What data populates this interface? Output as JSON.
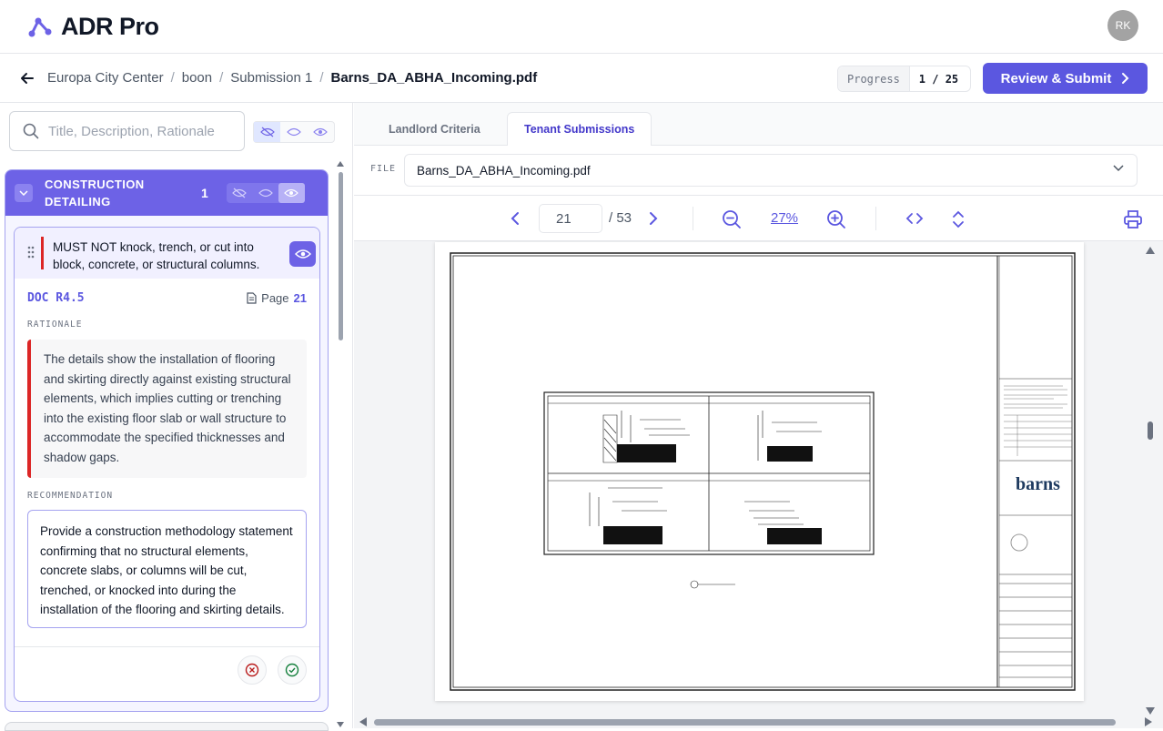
{
  "app": {
    "name": "ADR Pro",
    "avatar_initials": "RK"
  },
  "breadcrumb": {
    "items": [
      "Europa City Center",
      "boon",
      "Submission 1"
    ],
    "current": "Barns_DA_ABHA_Incoming.pdf"
  },
  "progress": {
    "label": "Progress",
    "value": "1 / 25"
  },
  "submit_label": "Review & Submit",
  "search": {
    "placeholder": "Title, Description, Rationale"
  },
  "section": {
    "title_line1": "CONSTRUCTION",
    "title_line2": "DETAILING",
    "count": "1"
  },
  "item": {
    "rule": "MUST NOT knock, trench, or cut into block, concrete, or structural columns.",
    "doc_ref": "DOC R4.5",
    "page_label": "Page",
    "page_num": "21",
    "rationale_label": "RATIONALE",
    "rationale": "The details show the installation of flooring and skirting directly against existing structural elements, which implies cutting or trenching into the existing floor slab or wall structure to accommodate the specified thicknesses and shadow gaps.",
    "recommendation_label": "RECOMMENDATION",
    "recommendation": "Provide a construction methodology statement confirming that no structural elements, concrete slabs, or columns will be cut, trenched, or knocked into during the installation of the flooring and skirting details."
  },
  "tabs": {
    "landlord": "Landlord Criteria",
    "tenant": "Tenant Submissions",
    "active": "tenant"
  },
  "file": {
    "label": "FILE",
    "value": "Barns_DA_ABHA_Incoming.pdf"
  },
  "viewer": {
    "page": "21",
    "total": "/ 53",
    "zoom": "27%"
  },
  "colors": {
    "accent": "#5b57e0",
    "section_header": "#6d62e6",
    "flag": "#dc2626"
  },
  "icons": [
    "logo-icon",
    "back-arrow-icon",
    "chevron-right-icon",
    "search-icon",
    "eye-off-icon",
    "eye-outline-icon",
    "eye-icon",
    "chevron-down-icon",
    "drag-handle-icon",
    "document-icon",
    "reject-icon",
    "approve-icon",
    "chevron-left-icon",
    "zoom-out-icon",
    "zoom-in-icon",
    "code-icon",
    "expand-vertical-icon",
    "printer-icon"
  ]
}
